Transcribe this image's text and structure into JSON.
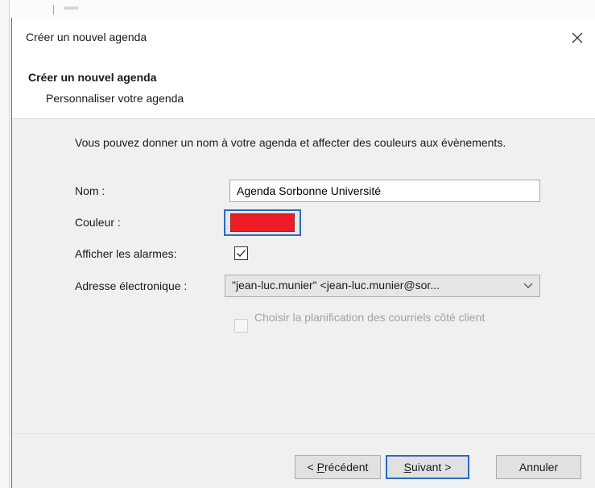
{
  "window": {
    "title": "Créer un nouvel agenda",
    "close_icon": "close-icon"
  },
  "header": {
    "title": "Créer un nouvel agenda",
    "subtitle": "Personnaliser votre agenda"
  },
  "content": {
    "intro": "Vous pouvez donner un nom à votre agenda et affecter des couleurs aux évènements.",
    "name_label": "Nom :",
    "name_value": "Agenda Sorbonne Université",
    "color_label": "Couleur :",
    "color_value": "#ee1c24",
    "alarms_label": "Afficher les alarmes:",
    "alarms_checked": true,
    "email_label": "Adresse électronique :",
    "email_selected": "\"jean-luc.munier\" <jean-luc.munier@sor...",
    "client_scheduling_label": "Choisir la planification des courriels côté client",
    "client_scheduling_checked": false
  },
  "buttons": {
    "prev_prefix": "< ",
    "prev_accel": "P",
    "prev_rest": "récédent",
    "next_accel": "S",
    "next_rest": "uivant >",
    "cancel": "Annuler"
  },
  "colors": {
    "accent": "#2a6ac0",
    "dialog_bg": "#f0f0f0",
    "header_bg": "#ffffff"
  }
}
